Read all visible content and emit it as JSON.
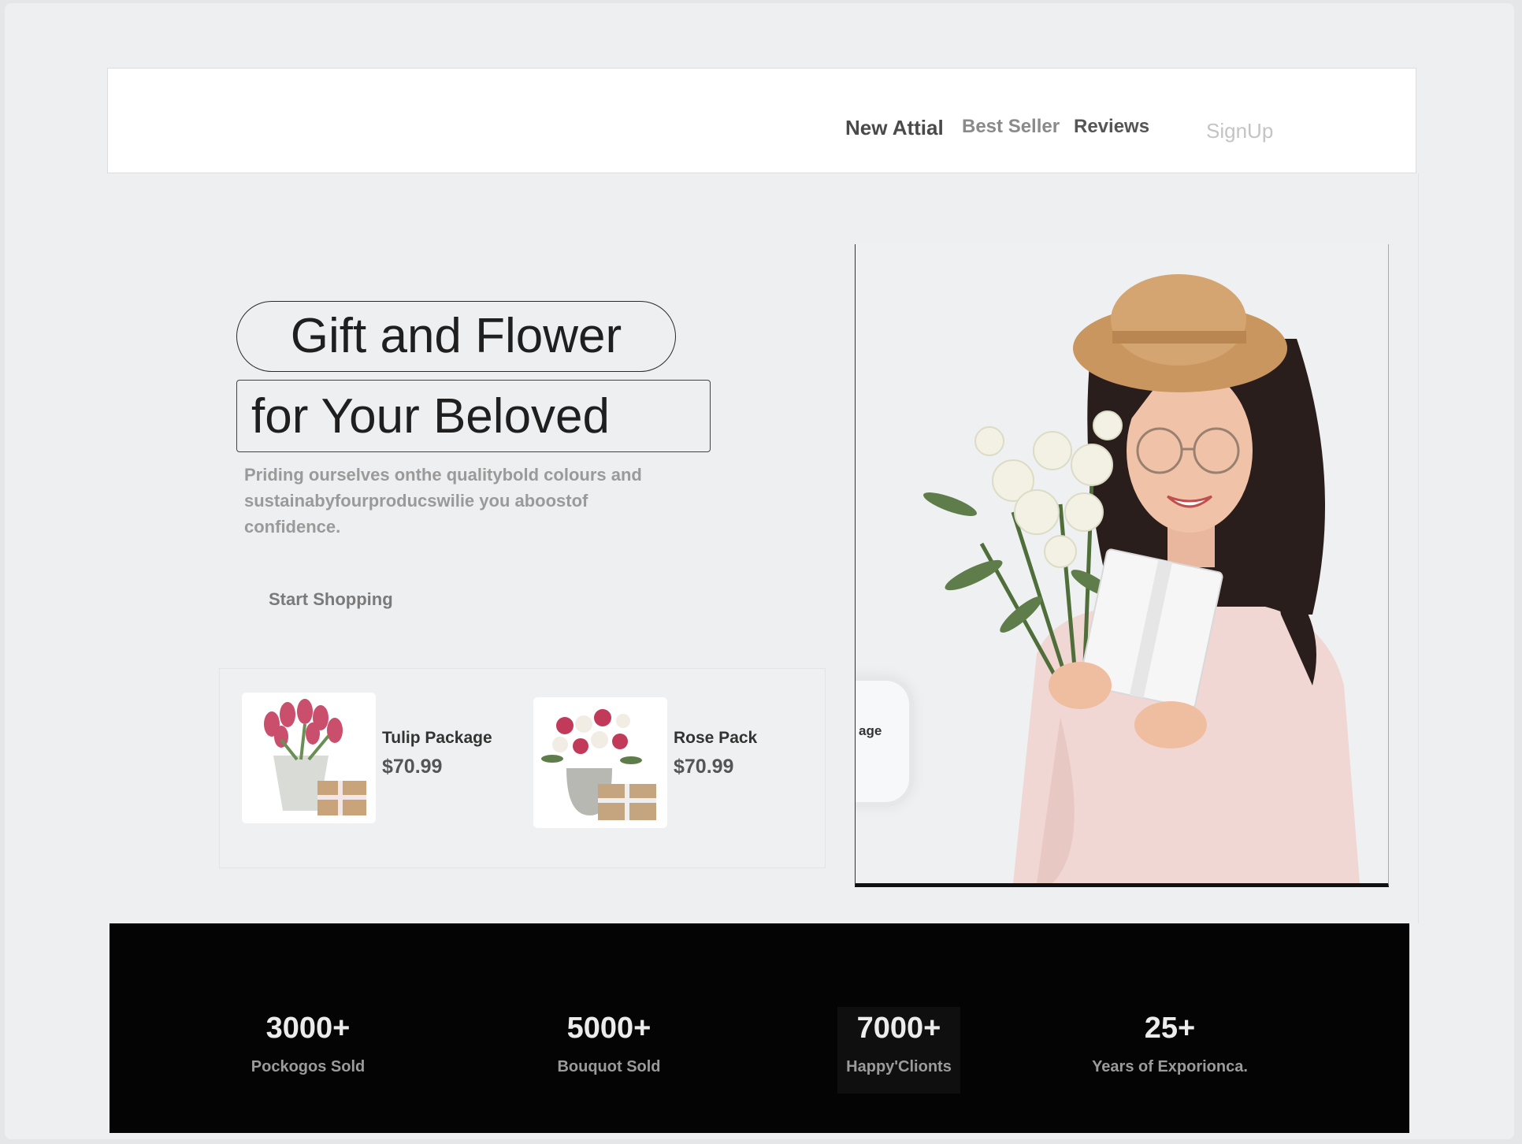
{
  "nav": {
    "links": [
      "New Attial",
      "Best Seller",
      "Reviews"
    ],
    "signup": "SignUp"
  },
  "hero": {
    "title_line1": "Gift and Flower",
    "title_line2": "for Your Beloved",
    "description": "Priding ourselves onthe qualitybold colours and sustainabyfourproducswilie you aboostof confidence.",
    "cta": "Start Shopping",
    "badge_text": "age"
  },
  "products": [
    {
      "name": "Tulip Package",
      "price": "$70.99"
    },
    {
      "name": "Rose Pack",
      "price": "$70.99"
    }
  ],
  "stats": [
    {
      "value": "3000+",
      "label": "Pockogos Sold"
    },
    {
      "value": "5000+",
      "label": "Bouquot Sold"
    },
    {
      "value": "7000+",
      "label": "Happy'Clionts"
    },
    {
      "value": "25+",
      "label": "Years of Exporionca."
    }
  ],
  "colors": {
    "background": "#eeeff0",
    "stats_bar": "#050404",
    "text_dark": "#1f1f1f",
    "text_muted": "#9a9a9a"
  }
}
